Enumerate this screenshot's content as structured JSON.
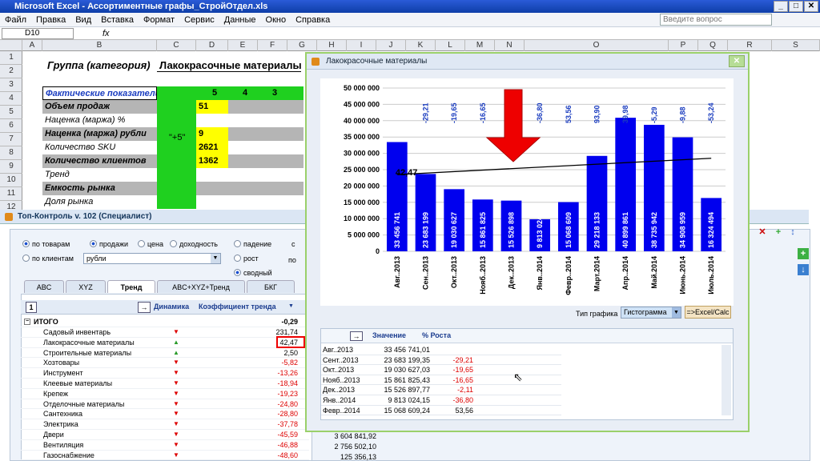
{
  "excel": {
    "title": "Microsoft Excel - Ассортиментные графы_СтройОтдел.xls",
    "menu": [
      "Файл",
      "Правка",
      "Вид",
      "Вставка",
      "Формат",
      "Сервис",
      "Данные",
      "Окно",
      "Справка"
    ],
    "help_placeholder": "Введите вопрос",
    "name_box": "D10",
    "fx": "fx",
    "columns": [
      "A",
      "B",
      "C",
      "D",
      "E",
      "F",
      "G",
      "H",
      "I",
      "J",
      "K",
      "L",
      "M",
      "N",
      "O",
      "P",
      "Q",
      "R",
      "S"
    ],
    "rows": [
      "1",
      "2",
      "3",
      "4",
      "5",
      "6",
      "7",
      "8",
      "9",
      "10",
      "11",
      "12"
    ],
    "group_label": "Группа (категория)",
    "group_value": "Лакокрасочные материалы",
    "section_header": "Фактические показатели",
    "col_numbers": [
      "5",
      "4",
      "3"
    ],
    "plus5": "\"+5\"",
    "row_labels": [
      {
        "text": "Объем продаж",
        "style": "bi"
      },
      {
        "text": "Наценка (маржа) %",
        "style": "it"
      },
      {
        "text": "Наценка (маржа) рубли",
        "style": "bi"
      },
      {
        "text": "Количество SKU",
        "style": "it"
      },
      {
        "text": "Количество клиентов",
        "style": "bi"
      },
      {
        "text": "Тренд",
        "style": "it"
      },
      {
        "text": "Емкость рынка",
        "style": "bi"
      },
      {
        "text": "Доля рынка",
        "style": "it"
      }
    ],
    "d_values": [
      "51",
      "",
      "9",
      "2621",
      "1362"
    ]
  },
  "topcontrol": {
    "title": "Топ-Контроль v. 102 (Специалист)",
    "radios": {
      "by_goods": "по товарам",
      "by_clients": "по клиентам",
      "sales": "продажи",
      "price": "цена",
      "income": "доходность",
      "fall": "падение",
      "growth": "рост",
      "summary": "сводный"
    },
    "currency": "рубли",
    "extra_c": "с",
    "extra_po": "по",
    "tabs": [
      "ABC",
      "XYZ",
      "Тренд",
      "ABC+XYZ+Тренд",
      "БКГ"
    ],
    "active_tab": "Тренд",
    "header": {
      "index": "1",
      "col_dyn": "Динамика",
      "col_coef": "Коэффициент тренда"
    },
    "total_label": "ИТОГО",
    "total_value": "-0,29",
    "rows": [
      {
        "name": "Садовый инвентарь",
        "dir": "down",
        "value": "231,74"
      },
      {
        "name": "Лакокрасочные материалы",
        "dir": "up",
        "value": "42,47"
      },
      {
        "name": "Строительные материалы",
        "dir": "up",
        "value": "2,50"
      },
      {
        "name": "Хозтовары",
        "dir": "down",
        "value": "-5,82"
      },
      {
        "name": "Инструмент",
        "dir": "down",
        "value": "-13,26"
      },
      {
        "name": "Клеевые материалы",
        "dir": "down",
        "value": "-18,94"
      },
      {
        "name": "Крепеж",
        "dir": "down",
        "value": "-19,23"
      },
      {
        "name": "Отделочные материалы",
        "dir": "down",
        "value": "-24,80"
      },
      {
        "name": "Сантехника",
        "dir": "down",
        "value": "-28,80"
      },
      {
        "name": "Электрика",
        "dir": "down",
        "value": "-37,78"
      },
      {
        "name": "Двери",
        "dir": "down",
        "value": "-45,59"
      },
      {
        "name": "Вентиляция",
        "dir": "down",
        "value": "-46,88"
      },
      {
        "name": "Газоснабжение",
        "dir": "down",
        "value": "-48,60"
      }
    ],
    "extra_values": [
      "3 604 841,92",
      "2 756 502,10",
      "125 356,13"
    ]
  },
  "chart_window": {
    "title": "Лакокрасочные материалы",
    "close": "✕",
    "chart_type_label": "Тип графика",
    "chart_type_value": "Гистограмма",
    "export_button": "=>Excel/Calc",
    "grid_headers": {
      "value": "Значение",
      "growth": "% Роста"
    },
    "grid_rows": [
      {
        "period": "Авг..2013",
        "value": "33 456 741,01",
        "growth": ""
      },
      {
        "period": "Сент..2013",
        "value": "23 683 199,35",
        "growth": "-29,21"
      },
      {
        "period": "Окт..2013",
        "value": "19 030 627,03",
        "growth": "-19,65"
      },
      {
        "period": "Нояб..2013",
        "value": "15 861 825,43",
        "growth": "-16,65"
      },
      {
        "period": "Дек..2013",
        "value": "15 526 897,77",
        "growth": "-2,11"
      },
      {
        "period": "Янв..2014",
        "value": "9 813 024,15",
        "growth": "-36,80"
      },
      {
        "period": "Февр..2014",
        "value": "15 068 609,24",
        "growth": "53,56"
      }
    ]
  },
  "chart_data": {
    "type": "bar",
    "categories": [
      "Авг..2013",
      "Сен..2013",
      "Окт..2013",
      "Нояб..2013",
      "Дек..2013",
      "Янв..2014",
      "Февр..2014",
      "Март.2014",
      "Апр..2014",
      "Май.2014",
      "Июнь.2014",
      "Июль.2014"
    ],
    "values": [
      33456741,
      23683199,
      19030627,
      15861825,
      15526898,
      9813024,
      15068609,
      29218133,
      40899861,
      38735942,
      34908959,
      16324494
    ],
    "bar_labels": [
      "33 456 741",
      "23 683 199",
      "19 030 627",
      "15 861 825",
      "15 526 898",
      "9 813 024",
      "15 068 609",
      "29 218 133",
      "40 899 861",
      "38 735 942",
      "34 908 959",
      "16 324 494"
    ],
    "growth_labels": [
      "",
      "-29,21",
      "-19,65",
      "-16,65",
      "-2,11",
      "-36,80",
      "53,56",
      "93,90",
      "39,98",
      "-5,29",
      "-9,88",
      "-53,24"
    ],
    "trend_label": "42,47",
    "trend_start": 23500000,
    "trend_end": 28500000,
    "ylim": [
      0,
      50000000
    ],
    "yticks": [
      "0",
      "5 000 000",
      "10 000 000",
      "15 000 000",
      "20 000 000",
      "25 000 000",
      "30 000 000",
      "35 000 000",
      "40 000 000",
      "45 000 000",
      "50 000 000"
    ],
    "bar_color": "#0000ee",
    "grid": true
  }
}
